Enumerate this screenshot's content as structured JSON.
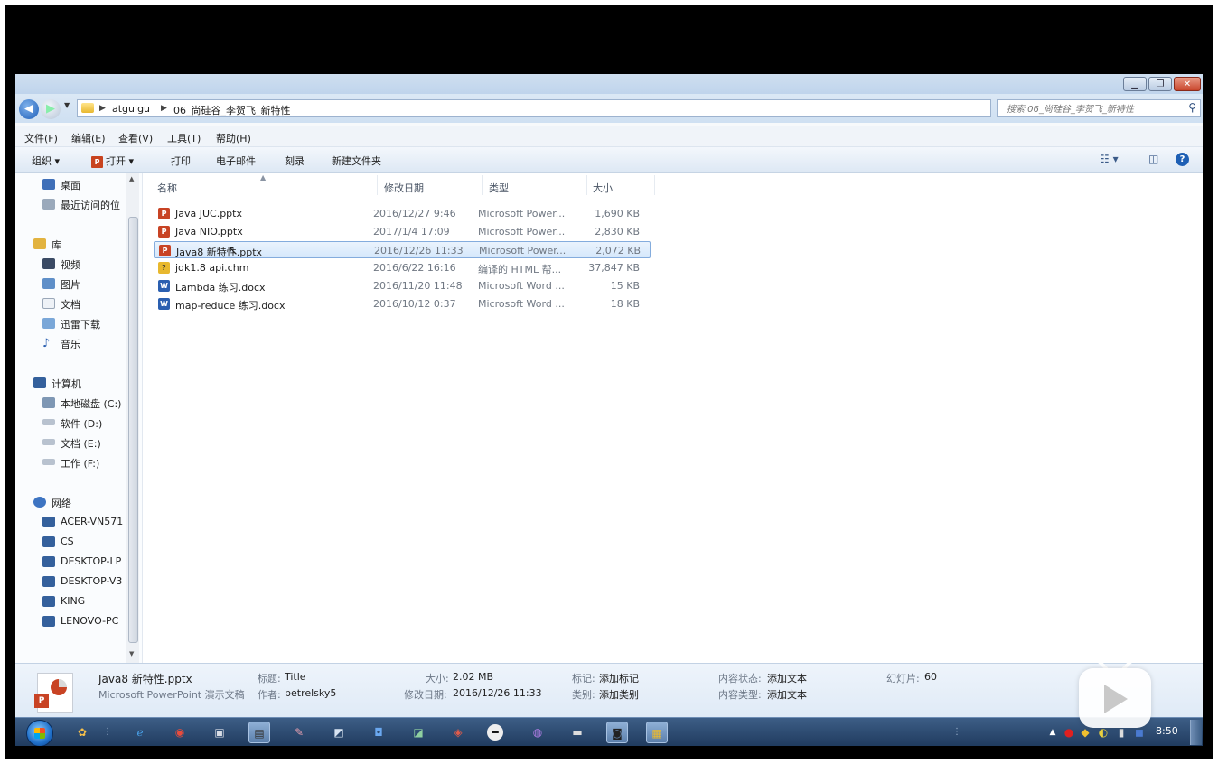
{
  "address": {
    "breadcrumb": [
      "atguigu",
      "06_尚硅谷_李贺飞_新特性"
    ],
    "search_placeholder": "搜索 06_尚硅谷_李贺飞_新特性"
  },
  "menubar": [
    "文件(F)",
    "编辑(E)",
    "查看(V)",
    "工具(T)",
    "帮助(H)"
  ],
  "commandbar": {
    "organize": "组织 ▾",
    "open": "打开 ▾",
    "print": "打印",
    "email": "电子邮件",
    "burn": "刻录",
    "new_folder": "新建文件夹"
  },
  "nav": {
    "favorites": [
      "桌面",
      "最近访问的位"
    ],
    "library": "库",
    "library_items": [
      "视频",
      "图片",
      "文档",
      "迅雷下载",
      "音乐"
    ],
    "computer": "计算机",
    "drives": [
      "本地磁盘 (C:)",
      "软件 (D:)",
      "文档 (E:)",
      "工作 (F:)"
    ],
    "network": "网络",
    "network_items": [
      "ACER-VN571",
      "CS",
      "DESKTOP-LP",
      "DESKTOP-V3",
      "KING",
      "LENOVO-PC"
    ]
  },
  "columns": {
    "name": "名称",
    "date": "修改日期",
    "type": "类型",
    "size": "大小"
  },
  "files": [
    {
      "name": "Java JUC.pptx",
      "date": "2016/12/27 9:46",
      "type": "Microsoft Power...",
      "size": "1,690 KB",
      "icon": "ppt"
    },
    {
      "name": "Java NIO.pptx",
      "date": "2017/1/4 17:09",
      "type": "Microsoft Power...",
      "size": "2,830 KB",
      "icon": "ppt"
    },
    {
      "name": "Java8 新特性.pptx",
      "date": "2016/12/26 11:33",
      "type": "Microsoft Power...",
      "size": "2,072 KB",
      "icon": "ppt"
    },
    {
      "name": "jdk1.8 api.chm",
      "date": "2016/6/22 16:16",
      "type": "编译的 HTML 帮...",
      "size": "37,847 KB",
      "icon": "chm"
    },
    {
      "name": "Lambda 练习.docx",
      "date": "2016/11/20 11:48",
      "type": "Microsoft Word ...",
      "size": "15 KB",
      "icon": "doc"
    },
    {
      "name": "map-reduce 练习.docx",
      "date": "2016/10/12 0:37",
      "type": "Microsoft Word ...",
      "size": "18 KB",
      "icon": "doc"
    }
  ],
  "details": {
    "filename": "Java8 新特性.pptx",
    "filetype": "Microsoft PowerPoint 演示文稿",
    "title_label": "标题:",
    "title_value": "Title",
    "author_label": "作者:",
    "author_value": "petrelsky5",
    "size_label": "大小:",
    "size_value": "2.02 MB",
    "modified_label": "修改日期:",
    "modified_value": "2016/12/26 11:33",
    "tags_label": "标记:",
    "tags_value": "添加标记",
    "category_label": "类别:",
    "category_value": "添加类别",
    "content_status_label": "内容状态:",
    "content_status_value": "添加文本",
    "content_type_label": "内容类型:",
    "content_type_value": "添加文本",
    "slides_label": "幻灯片:",
    "slides_value": "60"
  },
  "taskbar": {
    "clock": "8:50"
  },
  "colors": {
    "selection": "#d6e8fb",
    "taskbar": "#1f3a5e",
    "accent": "#1e5fb4"
  }
}
